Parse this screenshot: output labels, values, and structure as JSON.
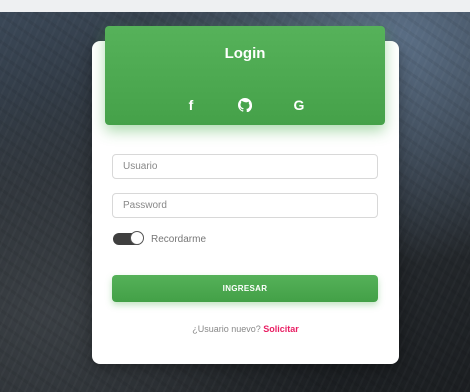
{
  "login": {
    "title": "Login",
    "socials": [
      {
        "glyph": "f",
        "icon": "facebook-icon"
      },
      {
        "glyph": "",
        "icon": "github-icon"
      },
      {
        "glyph": "G",
        "icon": "google-icon"
      }
    ],
    "username": {
      "value": "",
      "placeholder": "Usuario"
    },
    "password": {
      "value": "",
      "placeholder": "Password"
    },
    "remember": {
      "label": "Recordarme",
      "checked": true
    },
    "submit_label": "INGRESAR",
    "signup": {
      "prompt": "¿Usuario nuevo?",
      "link": "Solicitar"
    }
  },
  "colors": {
    "accent": "#4caf50",
    "link": "#e91e63"
  }
}
